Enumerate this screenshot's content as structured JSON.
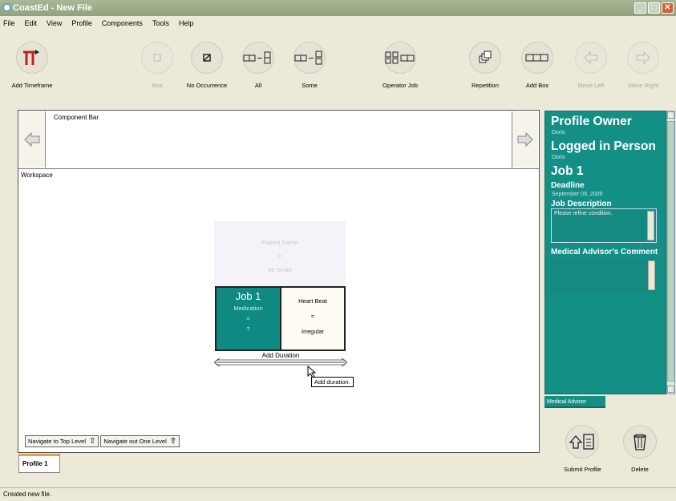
{
  "window": {
    "title": "CoastEd - New File"
  },
  "menu": [
    "File",
    "Edit",
    "View",
    "Profile",
    "Components",
    "Tools",
    "Help"
  ],
  "toolbar": {
    "add_timeframe": "Add Timeframe",
    "box": "Box",
    "no_occurrence": "No Occurrence",
    "all": "All",
    "some": "Some",
    "operator_job": "Operator Job",
    "repetition": "Repetition",
    "add_box": "Add Box",
    "move_left": "Move Left",
    "move_right": "Move Right"
  },
  "component_bar": {
    "label": "Component Bar"
  },
  "workspace": {
    "label": "Workspace",
    "patient": {
      "line1": "Patient Name",
      "line2": "=",
      "line3": "Mr Smith"
    },
    "job": {
      "title": "Job 1",
      "line1": "Medication",
      "line2": "=",
      "line3": "?"
    },
    "heart": {
      "line1": "Heart Beat",
      "line2": "=",
      "line3": "Irregular"
    },
    "add_duration": "Add Duration",
    "tooltip": "Add duration."
  },
  "nav": {
    "top_level": "Navigate to Top Level",
    "out_one_level": "Navigate out One Level"
  },
  "tabs": [
    "Profile 1"
  ],
  "status": "Created new file.",
  "right_panel": {
    "profile_owner_heading": "Profile Owner",
    "profile_owner_value": "Doris",
    "logged_in_heading": "Logged in Person",
    "logged_in_value": "Doris",
    "job_heading": "Job 1",
    "deadline_heading": "Deadline",
    "deadline_value": "September 09, 2009",
    "description_heading": "Job Description",
    "description_value": "Please refine condition.",
    "advisor_comment_heading": "Medical Advisor's Comment",
    "advisor_comment_value": "",
    "tab_label": "Medical Advisor"
  },
  "bottom_buttons": {
    "submit": "Submit Profile",
    "delete": "Delete"
  },
  "colors": {
    "teal": "#148f86",
    "job_teal": "#0e8a82",
    "tab_accent": "#e8a34a"
  }
}
